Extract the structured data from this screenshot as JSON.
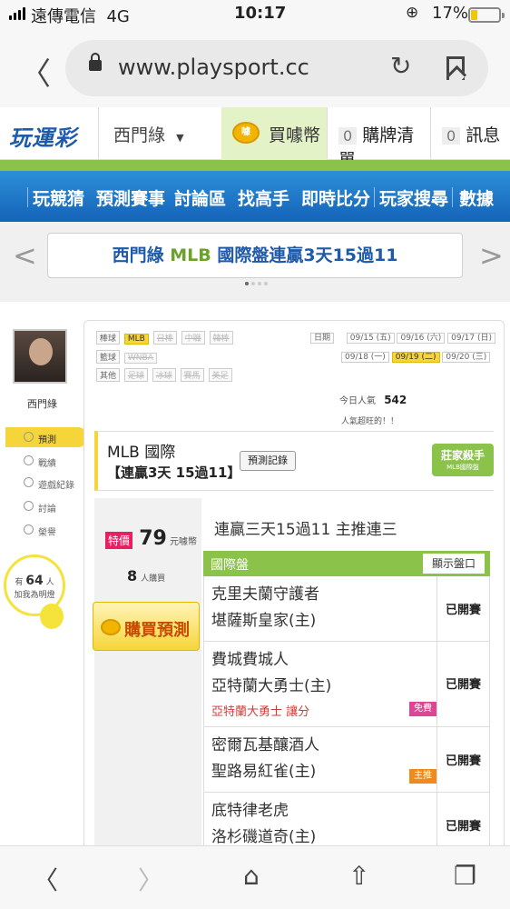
{
  "status_bar": {
    "carrier": "遠傳電信",
    "network": "4G",
    "time": "10:17",
    "battery": "17%"
  },
  "browser": {
    "url": "www.playsport.cc"
  },
  "site": {
    "logo": "玩運彩",
    "user": "西門綠",
    "buy_coin": "買噱幣",
    "shop_list_count": "0",
    "shop_list": "購牌清單",
    "message_count": "0",
    "message": "訊息",
    "coin_icon_text": "噱"
  },
  "nav": [
    "玩競猜",
    "預測賽事",
    "討論區",
    "找高手",
    "即時比分",
    "玩家搜尋",
    "數據"
  ],
  "banner": {
    "user": "西門綠",
    "league": "MLB",
    "text": "國際盤連贏3天15過11"
  },
  "profile": {
    "name": "西門綠",
    "menu": [
      "預測",
      "戰績",
      "遊戲紀錄",
      "討論",
      "榮譽"
    ],
    "fans_prefix": "有",
    "fans_count": "64",
    "fans_unit": "人",
    "fans_suffix": "加我為明燈"
  },
  "filters": {
    "baseball_label": "棒球",
    "baseball": [
      "MLB",
      "日棒",
      "中職",
      "韓棒"
    ],
    "basketball_label": "籃球",
    "basketball": [
      "WNBA"
    ],
    "other_label": "其他",
    "other": [
      "足球",
      "冰球",
      "賽馬",
      "美足"
    ],
    "date_label": "日期",
    "dates_row1": [
      "09/15 (五)",
      "09/16 (六)",
      "09/17 (日)"
    ],
    "dates_row2": [
      "09/18 (一)",
      "09/19 (二)",
      "09/20 (三)"
    ],
    "today_label": "今日人氣",
    "today_count": "542",
    "hot_text": "人氣超旺的！！"
  },
  "prediction": {
    "title": "MLB 國際",
    "streak": "【連贏3天 15過11】",
    "record_button": "預測記錄",
    "badge": "莊家殺手",
    "badge_sub": "MLB國際盤",
    "special_tag": "特價",
    "price": "79",
    "price_unit": "元噱幣",
    "buyers": "8",
    "buyers_unit": "人購買",
    "buy_button": "購買預測",
    "headline": "連贏三天15過11 主推連三",
    "market_label": "國際盤",
    "show_market_button": "顯示盤口"
  },
  "games": [
    {
      "away": "克里夫蘭守護者",
      "home": "堪薩斯皇家(主)",
      "status": "已開賽",
      "note": "",
      "tag": ""
    },
    {
      "away": "費城費城人",
      "home": "亞特蘭大勇士(主)",
      "status": "已開賽",
      "note": "亞特蘭大勇士 讓分",
      "tag": "免費"
    },
    {
      "away": "密爾瓦基釀酒人",
      "home": "聖路易紅雀(主)",
      "status": "已開賽",
      "note": "",
      "tag": "主推"
    },
    {
      "away": "底特律老虎",
      "home": "洛杉磯道奇(主)",
      "status": "已開賽",
      "note": "",
      "tag": ""
    }
  ]
}
